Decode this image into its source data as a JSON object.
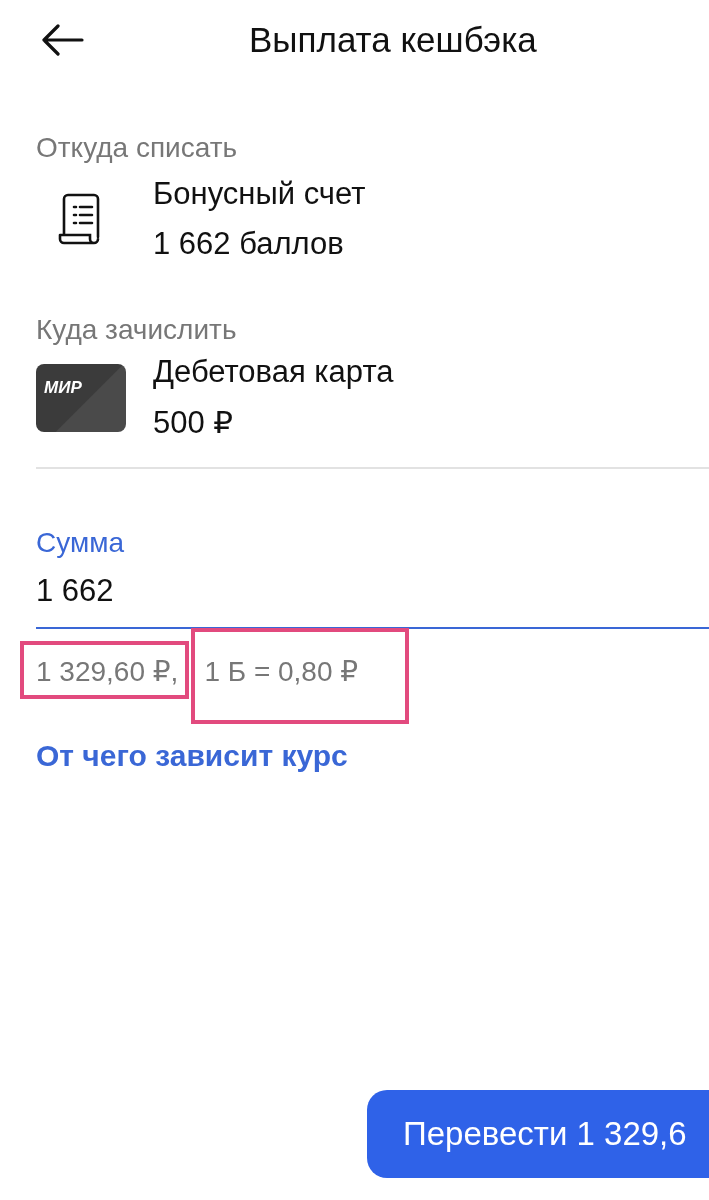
{
  "header": {
    "title": "Выплата кешбэка"
  },
  "source": {
    "label": "Откуда списать",
    "name": "Бонусный счет",
    "value": "1 662 баллов"
  },
  "destination": {
    "label": "Куда зачислить",
    "name": "Дебетовая карта",
    "value": "500 ₽",
    "card_brand": "МИР"
  },
  "amount": {
    "label": "Сумма",
    "value": "1 662",
    "total": "1 329,60 ₽,",
    "rate": "1 Б = 0,80 ₽"
  },
  "rate_link": "От чего зависит курс",
  "submit_button": "Перевести 1 329,6"
}
